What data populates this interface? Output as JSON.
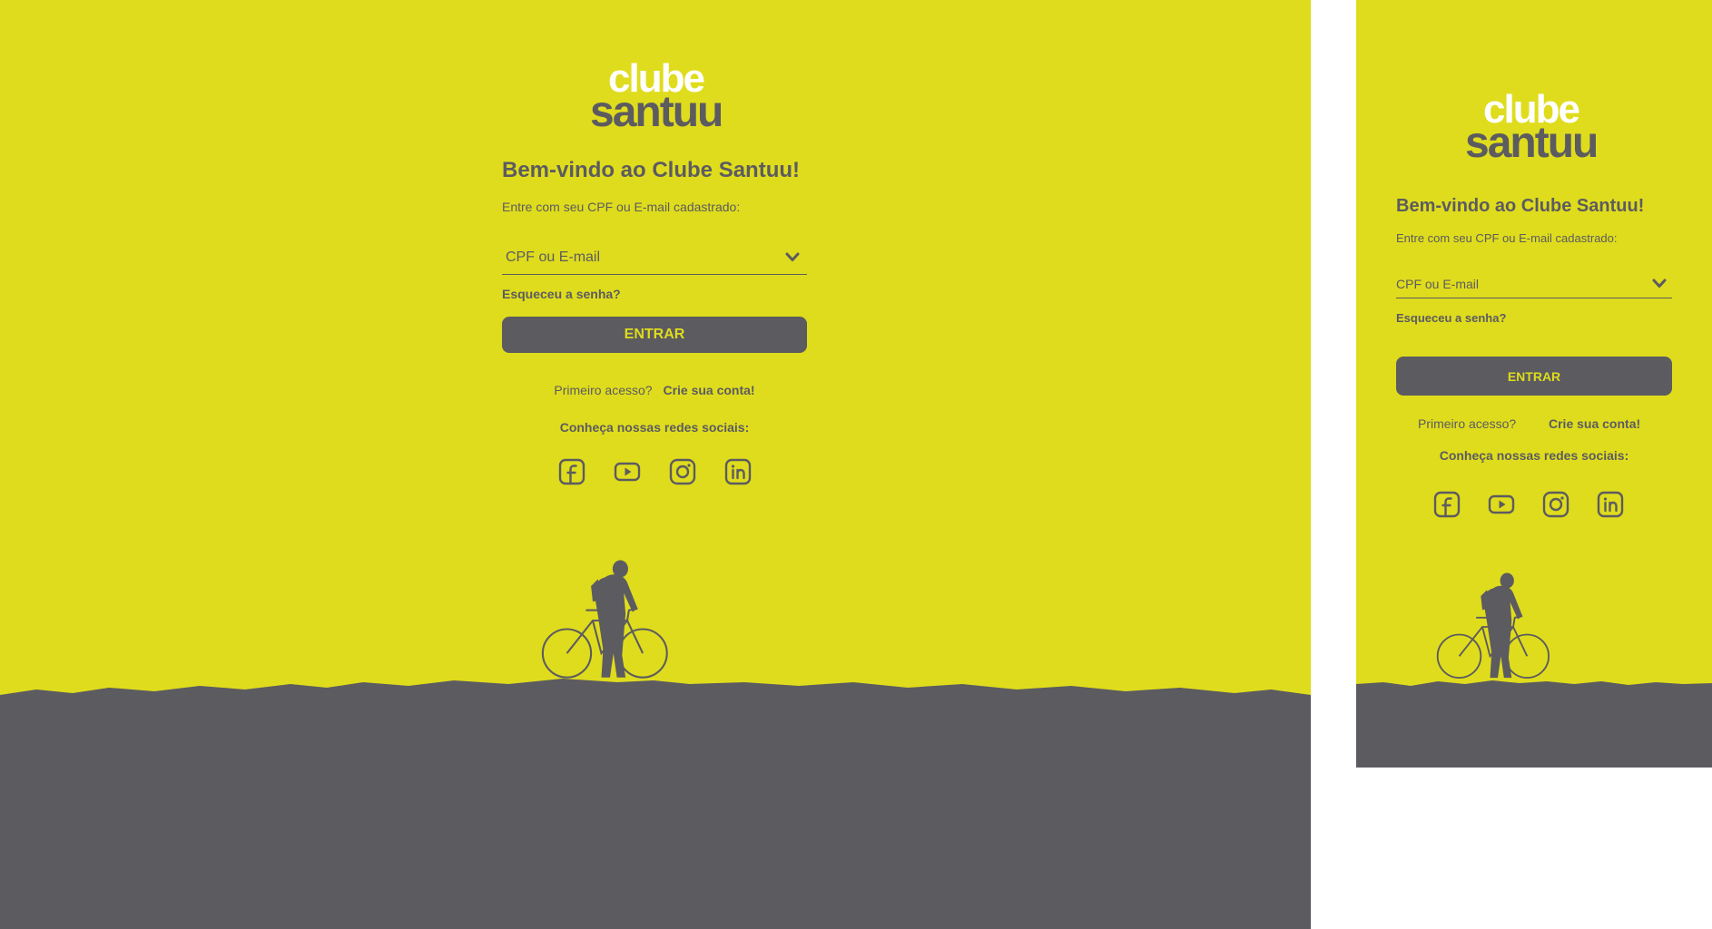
{
  "brand": {
    "logo_line1": "clube",
    "logo_line2": "santuu",
    "accent_color": "#dfdc1d",
    "dark_color": "#5c5b60"
  },
  "login": {
    "title": "Bem-vindo ao Clube Santuu!",
    "subtitle": "Entre com seu CPF ou E-mail cadastrado:",
    "field_placeholder": "CPF ou E-mail",
    "forgot_password": "Esqueceu a senha?",
    "submit_label": "ENTRAR",
    "first_access": "Primeiro acesso?",
    "create_account": "Crie sua conta!",
    "social_heading": "Conheça nossas redes sociais:"
  },
  "social_icons": [
    "facebook-icon",
    "youtube-icon",
    "instagram-icon",
    "linkedin-icon"
  ],
  "illustration": "cyclist-silhouette"
}
